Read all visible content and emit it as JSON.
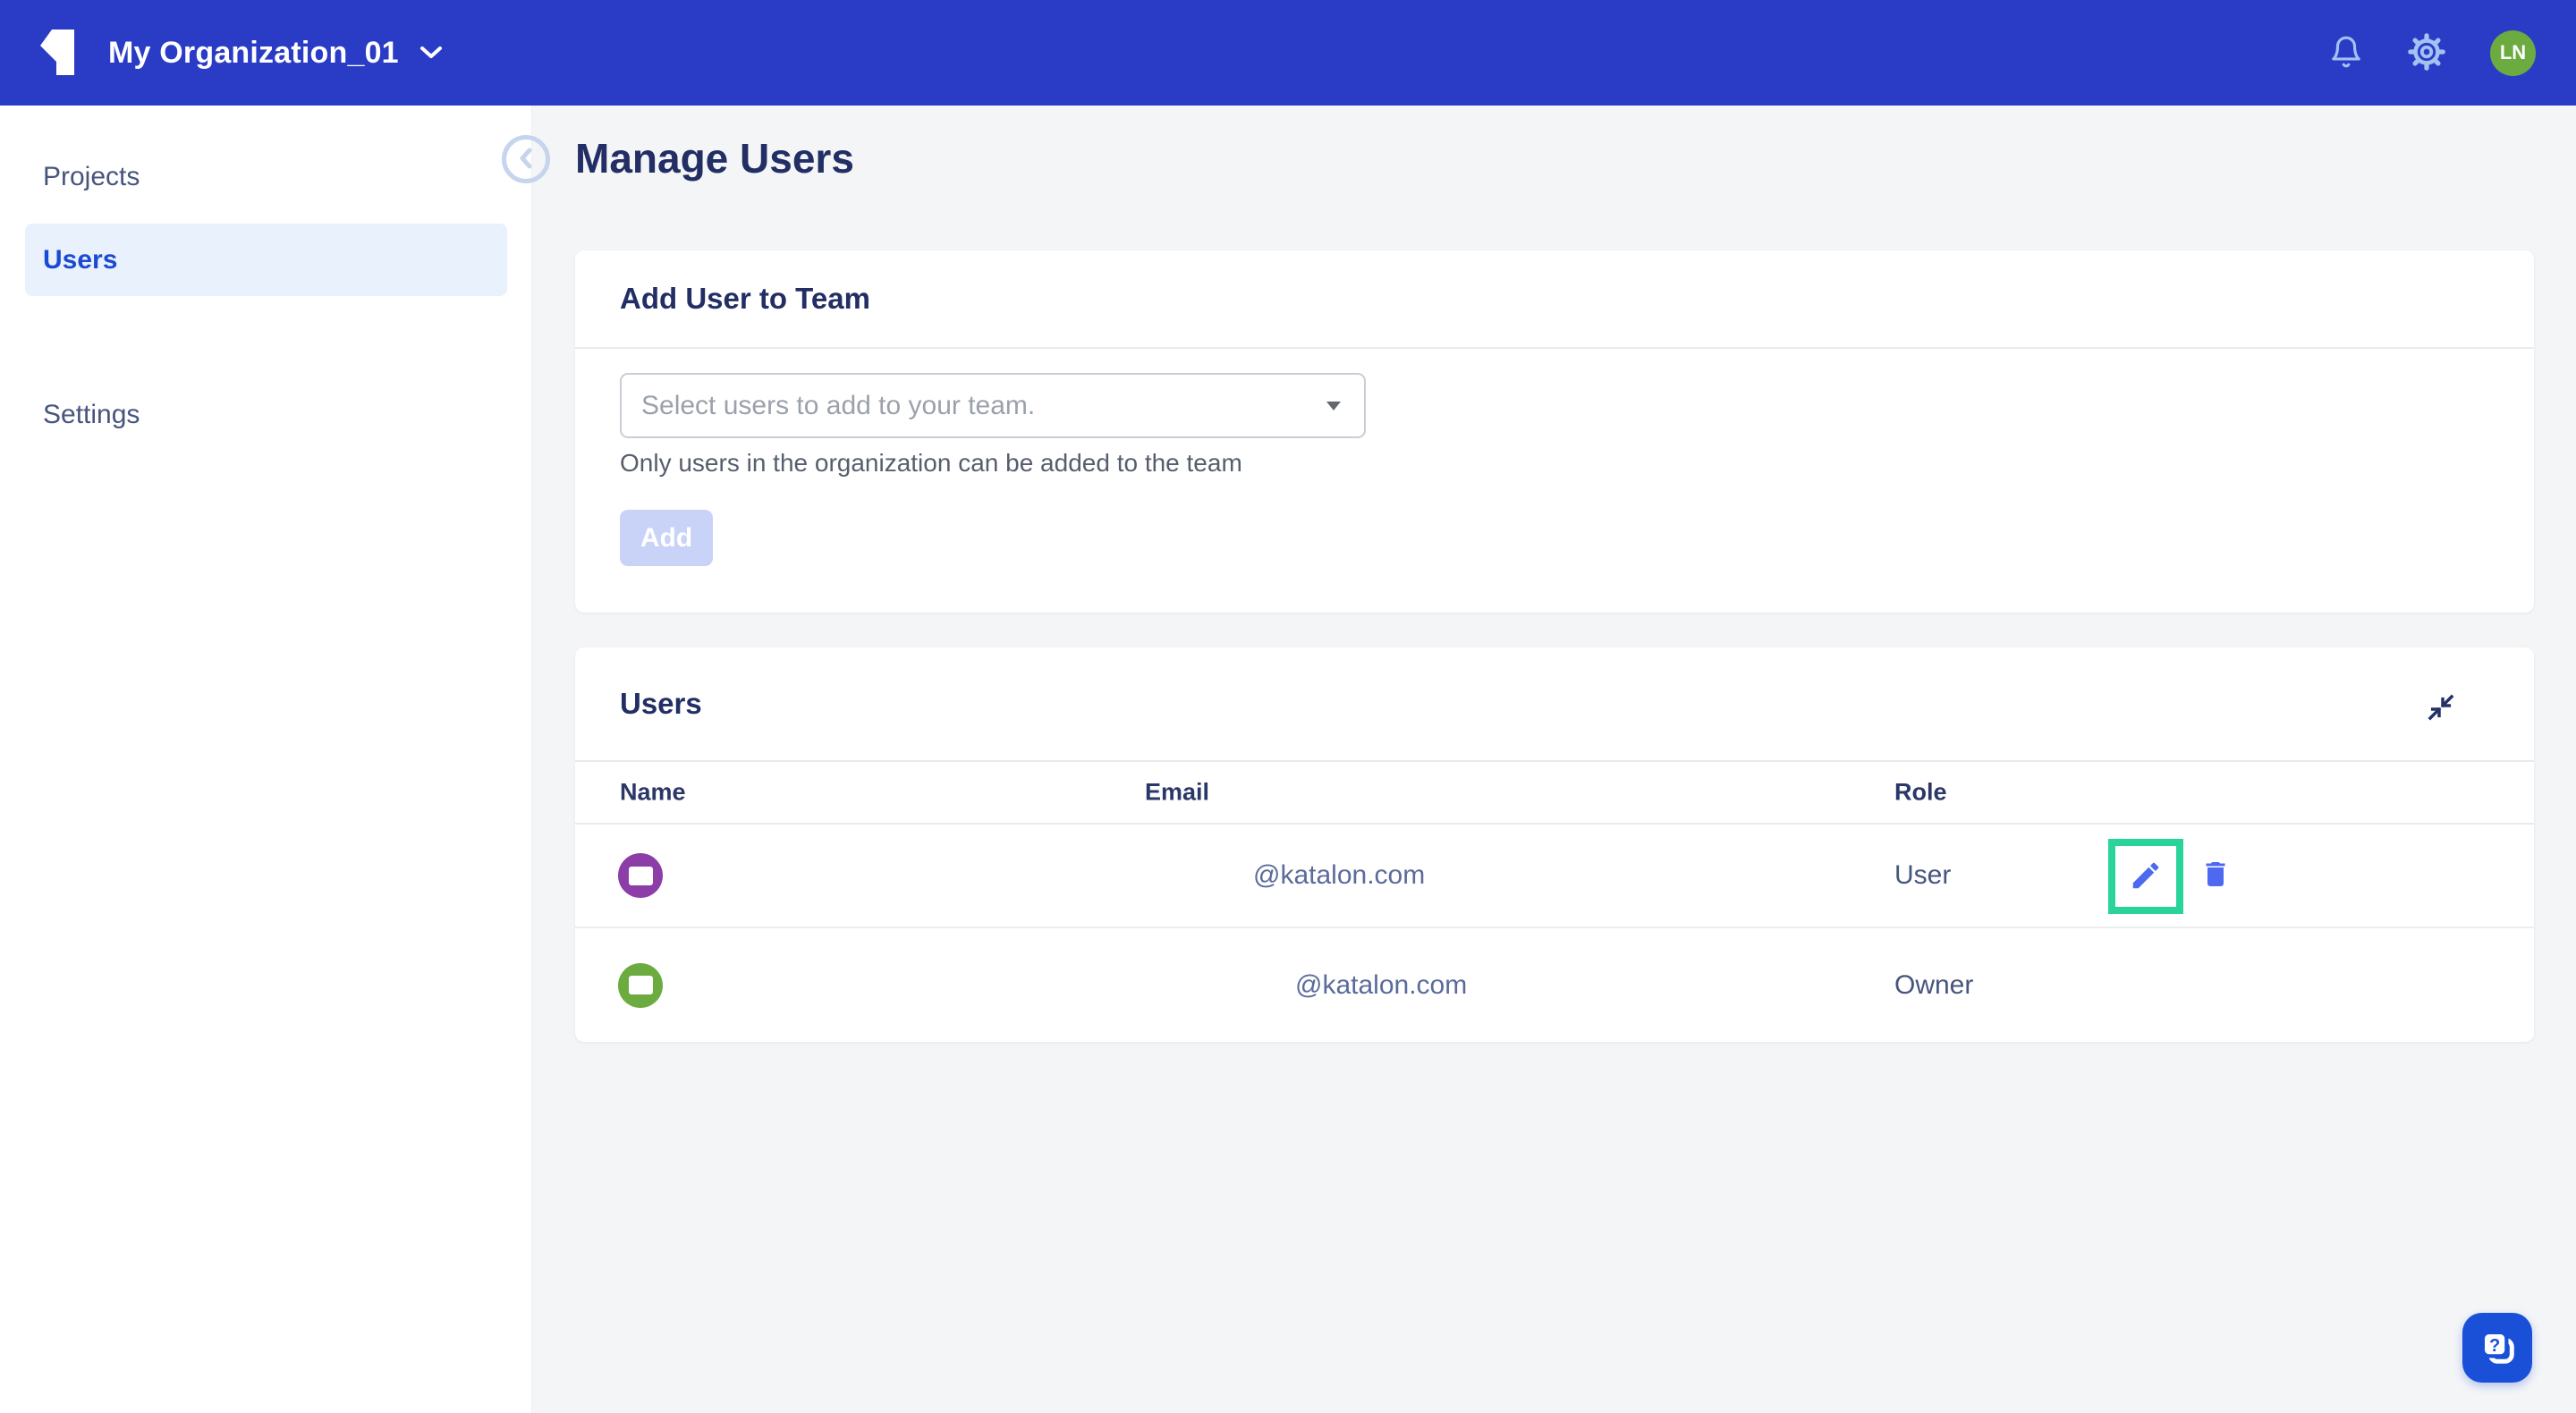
{
  "navbar": {
    "org_name": "My Organization_01",
    "avatar_initials": "LN"
  },
  "sidebar": {
    "items": [
      {
        "label": "Projects",
        "selected": false
      },
      {
        "label": "Users",
        "selected": true
      },
      {
        "label": "Settings",
        "selected": false
      }
    ]
  },
  "page": {
    "title": "Manage Users"
  },
  "add_user_card": {
    "title": "Add User to Team",
    "select_placeholder": "Select users to add to your team.",
    "helper_text": "Only users in the organization can be added to the team",
    "add_button_label": "Add"
  },
  "users_card": {
    "title": "Users",
    "columns": [
      "Name",
      "Email",
      "Role"
    ],
    "rows": [
      {
        "name": "",
        "email": "@katalon.com",
        "role": "User",
        "avatar_color": "#8C3DA8"
      },
      {
        "name": "",
        "email": "@katalon.com",
        "role": "Owner",
        "avatar_color": "#6BAB3F"
      }
    ]
  },
  "icons": {
    "navbar": [
      "katalon-logo",
      "chevron-down-icon",
      "bell-icon",
      "gear-icon"
    ],
    "page": [
      "back-chevron-icon",
      "collapse-icon",
      "dropdown-caret-icon"
    ],
    "row_actions": [
      "edit-pencil-icon",
      "trash-icon"
    ],
    "floating": [
      "help-chat-icon"
    ]
  },
  "colors": {
    "navbar_bg": "#2A3CC6",
    "navbar_icon_blue": "#A5C0F2",
    "avatar_green": "#6BAB3F",
    "avatar_purple": "#8C3DA8",
    "sidebar_selected_bg": "#E8F1FC",
    "sidebar_selected_text": "#1B49D3",
    "heading_navy": "#222E64",
    "action_indigo": "#4D69F0",
    "edit_highlight_green": "#29D49B",
    "chat_button_blue": "#1A4FD8",
    "disabled_add_bg": "#C8D3F7",
    "page_bg": "#F4F5F7"
  }
}
